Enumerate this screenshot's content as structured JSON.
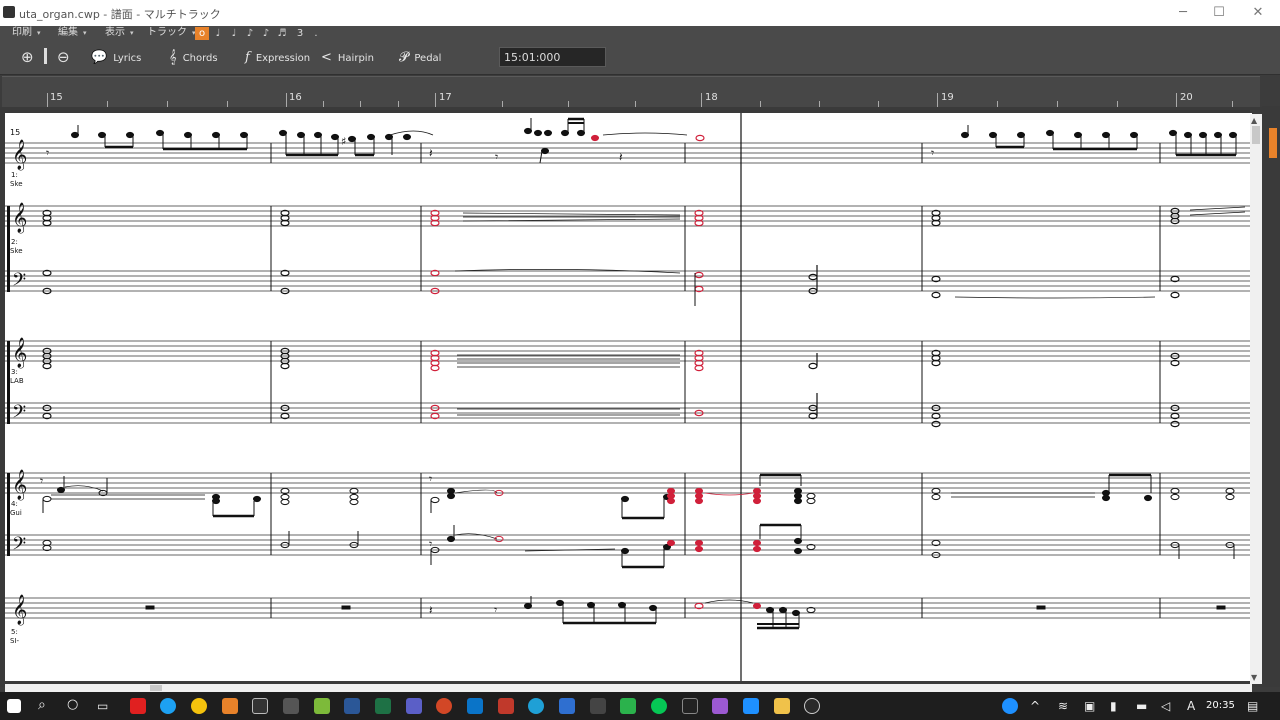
{
  "window": {
    "title": "uta_organ.cwp - 譜面 - マルチトラック",
    "min_symbol": "─",
    "max_symbol": "☐",
    "close_symbol": "✕"
  },
  "menus": [
    {
      "label": "印刷"
    },
    {
      "label": "編集"
    },
    {
      "label": "表示"
    },
    {
      "label": "トラック"
    }
  ],
  "durations": [
    "o",
    "♩",
    "♩",
    "♪",
    "♪",
    "♬",
    "3",
    "."
  ],
  "toolbar": {
    "zoom_in_icon": "⊕",
    "zoom_out_icon": "⊖",
    "lyrics_label": "Lyrics",
    "chords_label": "Chords",
    "expression_label": "Expression",
    "hairpin_label": "Hairpin",
    "pedal_label": "Pedal",
    "lyrics_icon": "💬",
    "chords_icon": "𝄞",
    "expression_icon": "f",
    "hairpin_icon": "<",
    "pedal_icon": "𝓟",
    "time": "15:01:000"
  },
  "ruler": {
    "measures": [
      "15",
      "16",
      "17",
      "18",
      "19",
      "20"
    ]
  },
  "score": {
    "first_measure": "15",
    "tracks": [
      {
        "number": "1:",
        "name": "Ske"
      },
      {
        "number": "2:",
        "name": "Ske"
      },
      {
        "number": "3:",
        "name": "LAB"
      },
      {
        "number": "4:",
        "name": "Gui"
      },
      {
        "number": "5:",
        "name": "SI-"
      }
    ]
  },
  "taskbar": {
    "clock": "20:35",
    "ime": "A"
  },
  "colors": {
    "selected_note": "#d0203a",
    "accent": "#e8822a"
  }
}
